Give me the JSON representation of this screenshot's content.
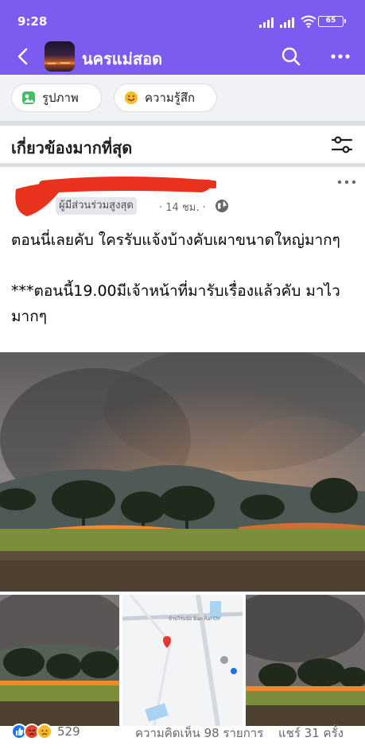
{
  "status_bar": {
    "time": "9:28",
    "battery": "65"
  },
  "app_bar": {
    "title": "นครแม่สอด",
    "icons": [
      "back-arrow-icon",
      "search-icon",
      "more-dots-icon"
    ],
    "color": "#7c5cf0"
  },
  "chips": [
    {
      "label": "รูปภาพ",
      "icon": "photo-icon"
    },
    {
      "label": "ความรู้สึก",
      "icon": "smiley-icon"
    }
  ],
  "sort": {
    "label": "เกี่ยวข้องมากที่สุด",
    "icon": "filter-sliders-icon"
  },
  "post": {
    "badge": "ผู้มีส่วนร่วมสูงสุด",
    "time": "· 14 ชม. ·",
    "text": "ตอนนี่เลยคับ ใครรับแจ้งบ้างคับเผาขนาดใหญ่มากๆ\n\n***ตอนนี้19.00มีเจ้าหน้าที่มารับเรื่องแล้วคับ มาไวมากๆ",
    "map_label": "บ้านไร่นนัย Ban Rai Ch"
  },
  "engagement": {
    "reaction_count": "529",
    "reaction_icons": [
      "like-icon",
      "angry-icon",
      "sad-icon"
    ],
    "comments": "ความคิดเห็น 98 รายการ",
    "shares": "แชร์ 31 ครั้ง"
  }
}
